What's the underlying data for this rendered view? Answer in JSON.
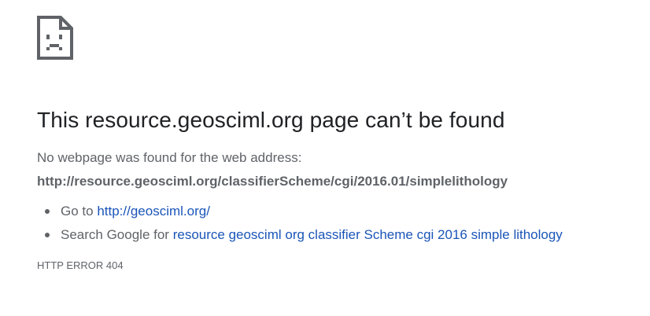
{
  "icon": "sad-page-icon",
  "title": "This resource.geosciml.org page can’t be found",
  "description": "No webpage was found for the web address:",
  "url": "http://resource.geosciml.org/classifierScheme/cgi/2016.01/simplelithology",
  "suggestions": {
    "goto_prefix": "Go to",
    "goto_link": "http://geosciml.org/",
    "search_prefix": "Search Google for",
    "search_link": "resource geosciml org classifier Scheme cgi 2016 simple lithology"
  },
  "error_code": "HTTP ERROR 404",
  "colors": {
    "text": "#202124",
    "secondary_text": "#5f6368",
    "link": "#1a55b8",
    "icon": "#5f6368"
  }
}
